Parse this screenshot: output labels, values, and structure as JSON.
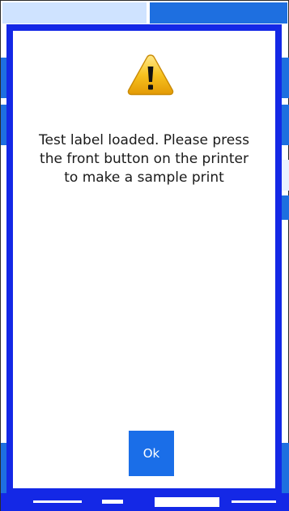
{
  "dialog": {
    "icon": "warning-icon",
    "message_lines": [
      "Test label loaded. Please press",
      "the front button on the printer",
      "to make a sample print"
    ],
    "ok_label": "Ok"
  },
  "colors": {
    "dialog_border": "#1428e6",
    "button_blue": "#1a6ee8",
    "background_tile": "#1e6fe0"
  }
}
